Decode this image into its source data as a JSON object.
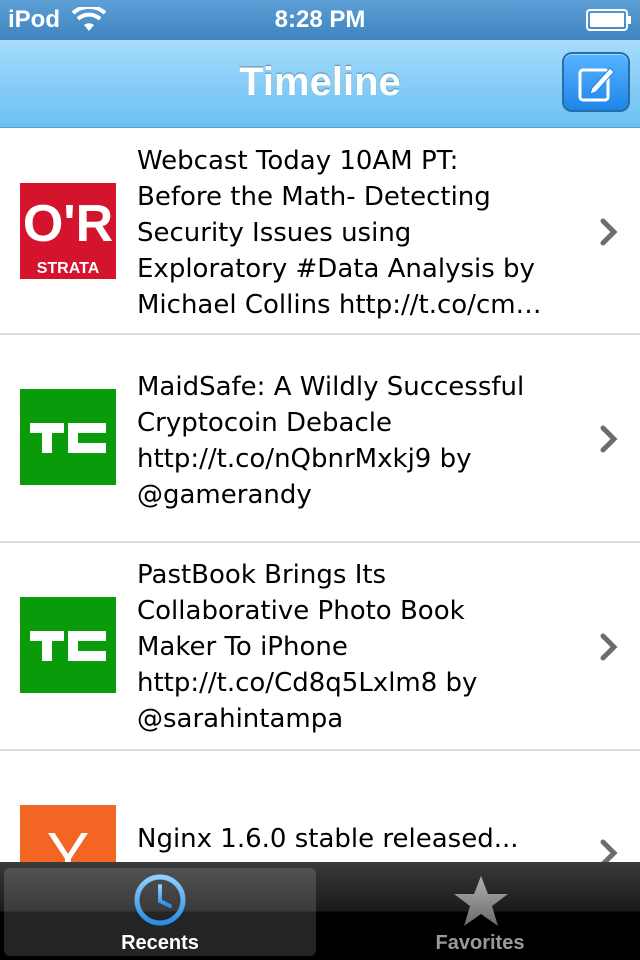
{
  "status_bar": {
    "carrier": "iPod",
    "time": "8:28 PM",
    "wifi_icon": "wifi-icon",
    "battery_icon": "battery-icon"
  },
  "nav": {
    "title": "Timeline",
    "compose_icon": "compose-icon"
  },
  "timeline": [
    {
      "avatar": "oreilly-strata-logo",
      "avatar_text": "O'R",
      "avatar_sub": "STRATA",
      "text": "Webcast Today 10AM PT:\nBefore the Math- Detecting\nSecurity Issues using\nExploratory #Data Analysis by\nMichael Collins http://t.co/cm…"
    },
    {
      "avatar": "techcrunch-logo",
      "avatar_text": "TC",
      "text": "MaidSafe: A Wildly Successful\nCryptocoin Debacle\nhttp://t.co/nQbnrMxkj9 by\n@gamerandy"
    },
    {
      "avatar": "techcrunch-logo",
      "avatar_text": "TC",
      "text": "PastBook Brings Its\nCollaborative Photo Book\nMaker To iPhone\nhttp://t.co/Cd8q5Lxlm8 by\n@sarahintampa"
    },
    {
      "avatar": "ycombinator-logo",
      "avatar_text": "Y",
      "text": "Nginx 1.6.0 stable released..."
    }
  ],
  "tabs": [
    {
      "label": "Recents",
      "icon": "clock-icon",
      "selected": true
    },
    {
      "label": "Favorites",
      "icon": "star-icon",
      "selected": false
    }
  ],
  "colors": {
    "nav_gradient_top": "#a7dcfa",
    "nav_gradient_bottom": "#6ec0f3",
    "compose_button": "#1f86e8",
    "strata_red": "#d3142c",
    "techcrunch_green": "#0a9b0a",
    "ycombinator_orange": "#f26522",
    "tab_active_icon": "#4aa8f0"
  }
}
